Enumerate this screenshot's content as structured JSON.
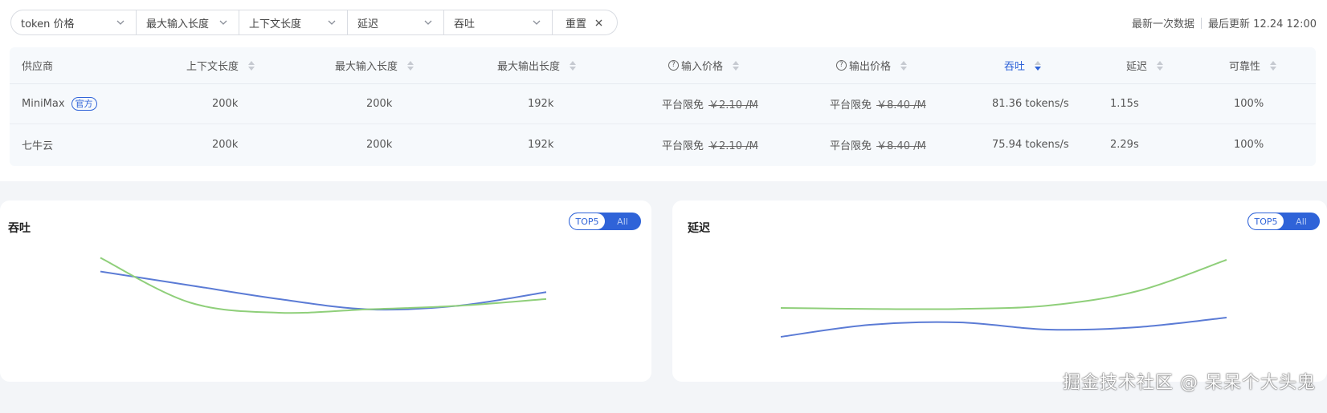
{
  "filters": {
    "items": [
      {
        "label": "token 价格"
      },
      {
        "label": "最大输入长度"
      },
      {
        "label": "上下文长度"
      },
      {
        "label": "延迟"
      },
      {
        "label": "吞吐"
      }
    ],
    "reset_label": "重置"
  },
  "meta": {
    "latest_label": "最新一次数据",
    "updated_label": "最后更新 12.24 12:00"
  },
  "table": {
    "headers": [
      "供应商",
      "上下文长度",
      "最大输入长度",
      "最大输出长度",
      "输入价格",
      "输出价格",
      "吞吐",
      "延迟",
      "可靠性"
    ],
    "rows": [
      {
        "provider": "MiniMax",
        "badge": "官方",
        "context": "200k",
        "max_input": "200k",
        "max_output": "192k",
        "input_price_label": "平台限免",
        "input_price": "￥2.10 /M",
        "output_price_label": "平台限免",
        "output_price": "￥8.40 /M",
        "throughput": "81.36 tokens/s",
        "latency": "1.15s",
        "reliability": "100%"
      },
      {
        "provider": "七牛云",
        "context": "200k",
        "max_input": "200k",
        "max_output": "192k",
        "input_price_label": "平台限免",
        "input_price": "￥2.10 /M",
        "output_price_label": "平台限免",
        "output_price": "￥8.40 /M",
        "throughput": "75.94 tokens/s",
        "latency": "2.29s",
        "reliability": "100%"
      }
    ]
  },
  "charts": {
    "throughput": {
      "title": "吞吐",
      "toggle_on": "TOP5",
      "toggle_off": "All"
    },
    "latency": {
      "title": "延迟",
      "toggle_on": "TOP5",
      "toggle_off": "All"
    }
  },
  "chart_data": [
    {
      "type": "line",
      "title": "吞吐",
      "x": [
        0,
        1,
        2,
        3,
        4,
        5
      ],
      "series": [
        {
          "color": "#5b7bd5",
          "values": [
            86,
            82,
            78,
            75,
            76,
            80
          ]
        },
        {
          "color": "#8fcf7a",
          "values": [
            90,
            77,
            74,
            75,
            76,
            78
          ]
        }
      ],
      "ylim": [
        60,
        95
      ],
      "grid": false
    },
    {
      "type": "line",
      "title": "延迟",
      "x": [
        0,
        1,
        2,
        3,
        4,
        5
      ],
      "series": [
        {
          "color": "#5b7bd5",
          "values": [
            1.0,
            1.25,
            1.3,
            1.15,
            1.2,
            1.4
          ]
        },
        {
          "color": "#8fcf7a",
          "values": [
            1.6,
            1.58,
            1.58,
            1.65,
            1.95,
            2.6
          ]
        }
      ],
      "ylim": [
        0.5,
        3.0
      ],
      "grid": false
    }
  ],
  "colors": {
    "accent": "#2f63d8",
    "series_a": "#5b7bd5",
    "series_b": "#8fcf7a"
  },
  "watermark": "掘金技术社区 @ 呆呆个大头鬼"
}
